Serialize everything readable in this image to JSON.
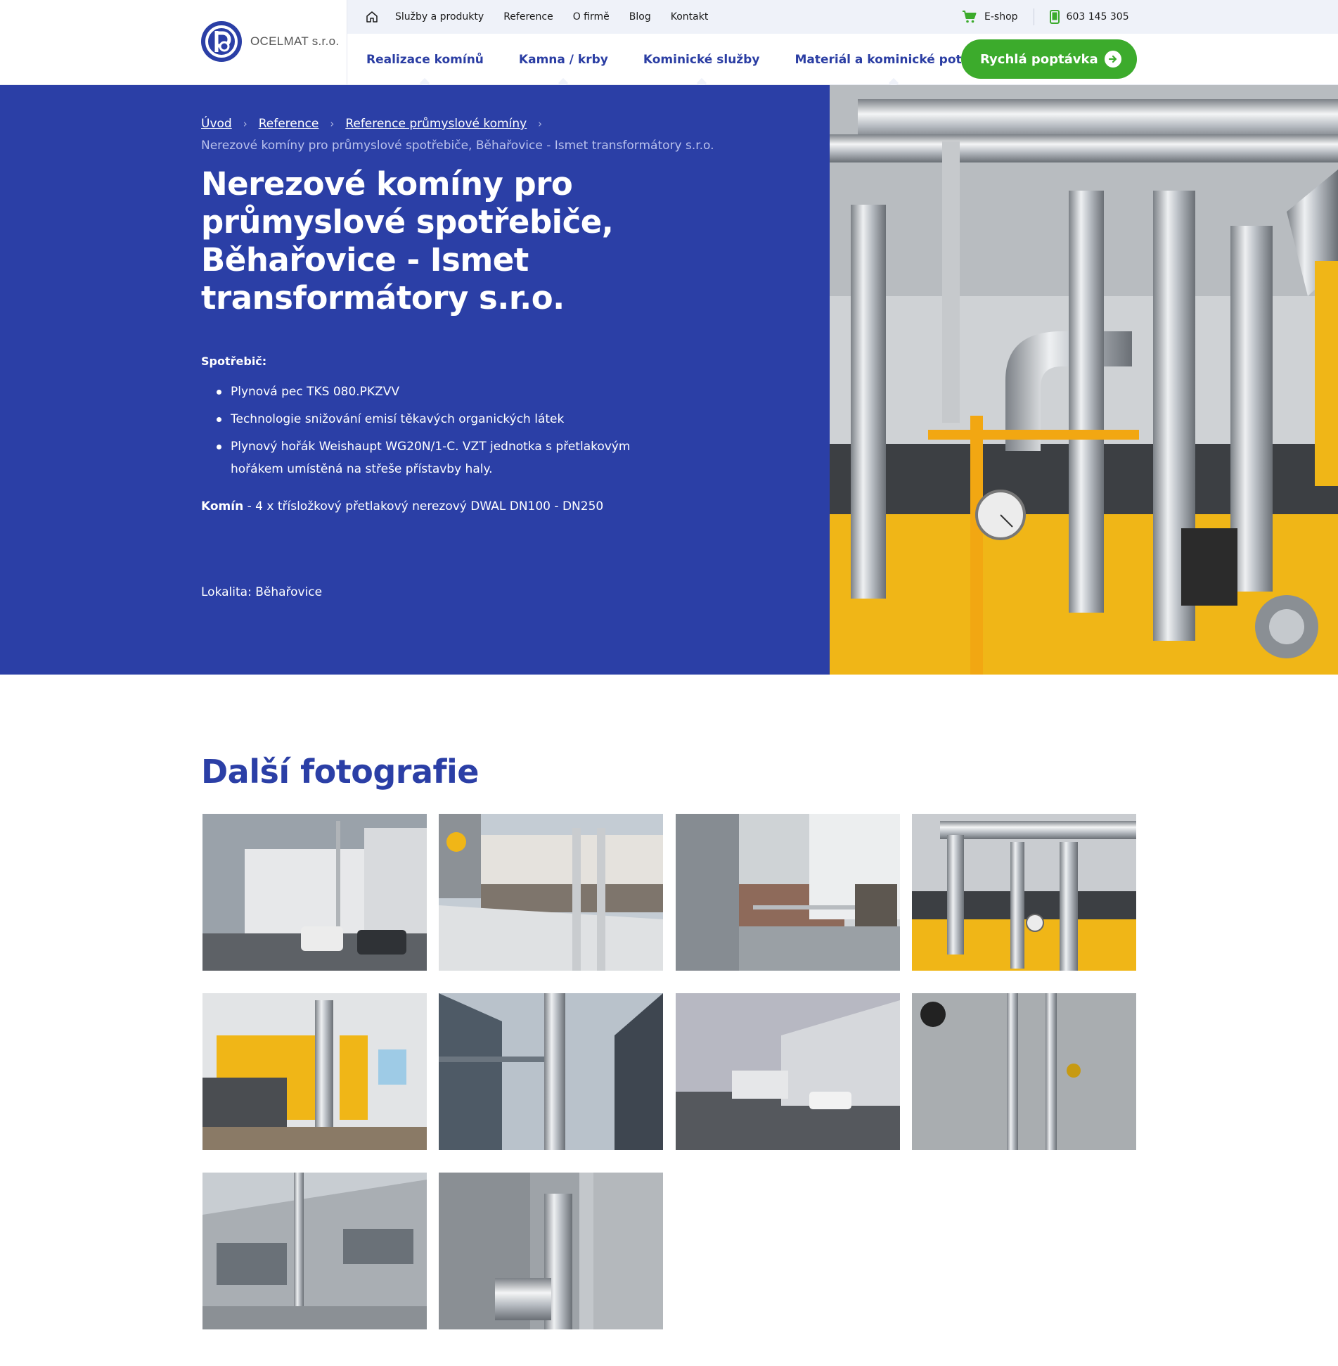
{
  "brand": {
    "name": "OCELMAT s.r.o.",
    "primary": "#2b3fa6",
    "accent": "#3cab2c"
  },
  "topnav": {
    "items": [
      "Služby a produkty",
      "Reference",
      "O firmě",
      "Blog",
      "Kontakt"
    ],
    "eshop": "E-shop",
    "phone": "603 145 305"
  },
  "mainnav": {
    "items": [
      "Realizace komínů",
      "Kamna / krby",
      "Kominické služby",
      "Materiál a kominické potřeby"
    ],
    "cta": "Rychlá poptávka"
  },
  "breadcrumb": {
    "items": [
      "Úvod",
      "Reference",
      "Reference průmyslové komíny"
    ],
    "current": "Nerezové komíny pro průmyslové spotřebiče, Běhařovice - Ismet transformátory s.r.o."
  },
  "hero": {
    "title": "Nerezové komíny pro průmyslové spotřebiče, Běhařovice - Ismet transformátory s.r.o.",
    "appliance_label": "Spotřebič:",
    "bullets": [
      "Plynová pec TKS 080.PKZVV",
      "Technologie snižování emisí těkavých organických látek",
      "Plynový hořák Weishaupt WG20N/1-C. VZT jednotka s přetlakovým hořákem umístěná na střeše přístavby haly."
    ],
    "chimney_label": "Komín",
    "chimney_text": " - 4 x třísložkový přetlakový nerezový DWAL DN100 - DN250",
    "locality": "Lokalita: Běhařovice"
  },
  "gallery": {
    "title": "Další fotografie",
    "photo_count": 10
  }
}
